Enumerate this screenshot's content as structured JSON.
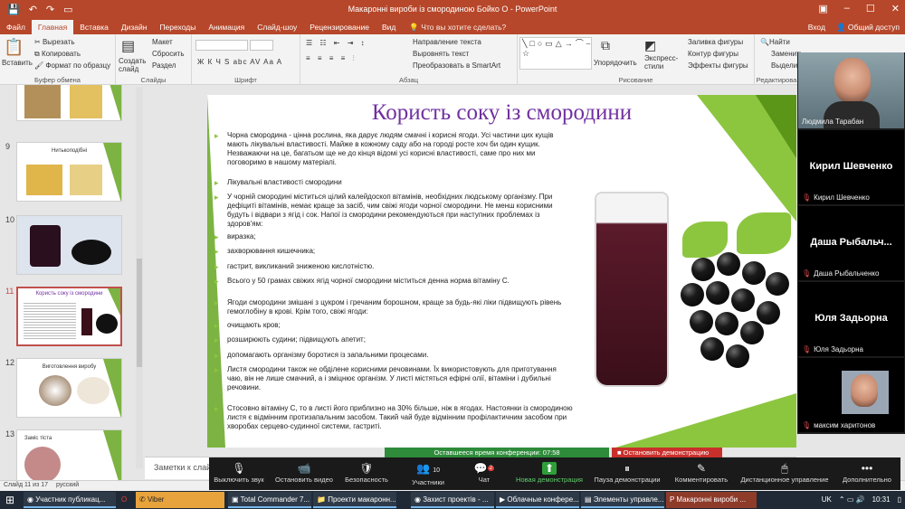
{
  "window": {
    "title": "Макаронні вироби із смородиною Бойко О - PowerPoint"
  },
  "tabs": [
    {
      "label": "Файл"
    },
    {
      "label": "Главная"
    },
    {
      "label": "Вставка"
    },
    {
      "label": "Дизайн"
    },
    {
      "label": "Переходы"
    },
    {
      "label": "Анимация"
    },
    {
      "label": "Слайд-шоу"
    },
    {
      "label": "Рецензирование"
    },
    {
      "label": "Вид"
    }
  ],
  "tell_me": "Что вы хотите сделать?",
  "account": {
    "signin": "Вход",
    "share": "Общий доступ"
  },
  "ribbon": {
    "paste": "Вставить",
    "cut": "Вырезать",
    "copy": "Копировать",
    "format_painter": "Формат по образцу",
    "clipboard_label": "Буфер обмена",
    "new_slide": "Создать слайд",
    "layout": "Макет",
    "reset": "Сбросить",
    "section": "Раздел",
    "slides_label": "Слайды",
    "font_label": "Шрифт",
    "font_buttons": "Ж К Ч S abc AV Aa A",
    "text_direction": "Направление текста",
    "align_text": "Выровнять текст",
    "smartart": "Преобразовать в SmartArt",
    "paragraph_label": "Абзац",
    "arrange": "Упорядочить",
    "quick_styles": "Экспресс-стили",
    "shape_fill": "Заливка фигуры",
    "shape_outline": "Контур фигуры",
    "shape_effects": "Эффекты фигуры",
    "drawing_label": "Рисование",
    "find": "Найти",
    "replace": "Заменить",
    "select": "Выделить",
    "editing_label": "Редактирова"
  },
  "thumbnails": [
    {
      "num": "",
      "title": ""
    },
    {
      "num": "9",
      "title": "Нитькоподібні"
    },
    {
      "num": "10",
      "title": ""
    },
    {
      "num": "11",
      "title": "Користь соку із смородини"
    },
    {
      "num": "12",
      "title": "Виготовлення виробу"
    },
    {
      "num": "13",
      "title": "Заміс тіста"
    }
  ],
  "slide": {
    "title": "Користь соку із смородини",
    "bullets": [
      "Чорна смородина - цінна рослина, яка дарує людям смачні і корисні ягоди. Усі частини цих кущів мають лікувальні властивості. Майже в кожному саду або на городі росте хоч би один кущик. Незважаючи на це, багатьом ще не до кінця відомі усі корисні властивості, саме про них ми поговоримо в нашому матеріалі.",
      "Лікувальні властивості смородини",
      "У чорній смородині міститься цілий калейдоскоп вітамінів, необхідних людському організму. При дефіциті вітамінів, немає краще за засіб, чим свіжі ягоди чорної смородини. Не менш корисними будуть і відвари з ягід і сок. Напої із смородини рекомендуються при наступних проблемах із здоров'ям:",
      "виразка;",
      "захворювання кишечника;",
      "гастрит, викликаний зниженою кислотністю.",
      "Всього у 50 грамах свіжих ягід чорної смородини міститься денна норма вітаміну С.",
      "Ягоди смородини змішані з цукром і гречаним борошном, краще за будь-які ліки підвищують рівень гемоглобіну в крові. Крім того, свіжі ягоди:",
      "очищають кров;",
      "розширюють судини; підвищують апетит;",
      "допомагають організму боротися із запальними процесами.",
      "Листя смородини також не обділене корисними речовинами. Їх використовують для приготування чаю, він не лише смачний, а і зміцнює організм. У листі містяться ефірні олії, вітаміни і дубильні речовини.",
      "Стосовно вітаміну С, то в листі його приблизно на 30% більше, ніж в ягодах. Настоянки із смородиною листя є відмінним протизапальним засобом. Такий чай буде відмінним профілактичним засобом при хворобах серцево-судинної системи, гастриті."
    ]
  },
  "notes": {
    "placeholder": "Заметки к слайду"
  },
  "status": {
    "slide_of": "Слайд 11 из 17",
    "language": "русский"
  },
  "zoom": {
    "remaining_time": "Оставшееся время конференции: 07:58",
    "stop_share": "Остановить демонстрацию",
    "toolbar": [
      {
        "label": "Выключить звук",
        "icon": "🎙"
      },
      {
        "label": "Остановить видео",
        "icon": "📹"
      },
      {
        "label": "Безопасность",
        "icon": "🛡"
      },
      {
        "label": "Участники",
        "icon": "👥",
        "badge": "10"
      },
      {
        "label": "Чат",
        "icon": "💬",
        "badge": "2"
      },
      {
        "label": "Новая демонстрация",
        "icon": "⬆"
      },
      {
        "label": "Пауза демонстрации",
        "icon": "⏸"
      },
      {
        "label": "Комментировать",
        "icon": "✎"
      },
      {
        "label": "Дистанционное управление",
        "icon": "🖱"
      },
      {
        "label": "Дополнительно",
        "icon": "•••"
      }
    ],
    "participants": [
      {
        "name": "Людмила Тарабан",
        "display": ""
      },
      {
        "name": "Кирил Шевченко",
        "display": "Кирил Шевченко"
      },
      {
        "name": "Даша Рыбальченко",
        "display": "Даша Рыбальч..."
      },
      {
        "name": "Юля Задьорна",
        "display": "Юля Задьорна"
      },
      {
        "name": "максим харитонов",
        "display": ""
      }
    ]
  },
  "taskbar": {
    "items": [
      "Участник публикац...",
      "Viber",
      "Total Commander 7...",
      "Проекти макаронн...",
      "Захист проектів - ...",
      "Облачные конфере...",
      "Элементы управле...",
      "Макаронні вироби ..."
    ],
    "lang": "UK",
    "time": "10:31"
  }
}
